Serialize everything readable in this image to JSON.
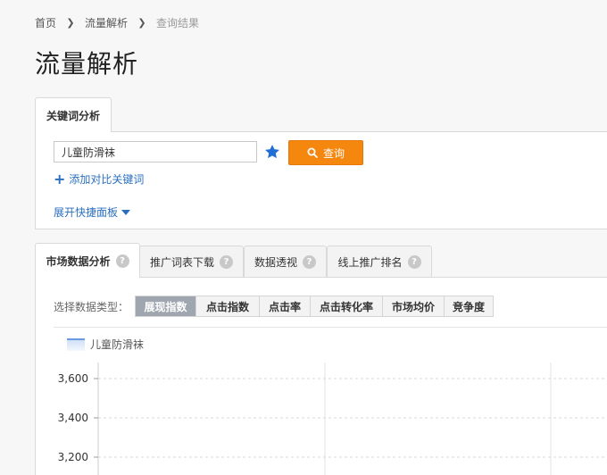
{
  "breadcrumb": {
    "home": "首页",
    "section": "流量解析",
    "current": "查询结果"
  },
  "page_title": "流量解析",
  "keyword_tab": {
    "label": "关键词分析"
  },
  "keyword_search": {
    "value": "儿童防滑袜",
    "search_label": "查询",
    "add_compare_label": "添加对比关键词",
    "expand_panel_label": "展开快捷面板"
  },
  "tabs": [
    {
      "label": "市场数据分析",
      "active": true
    },
    {
      "label": "推广词表下载",
      "active": false
    },
    {
      "label": "数据透视",
      "active": false
    },
    {
      "label": "线上推广排名",
      "active": false
    }
  ],
  "data_type": {
    "label": "选择数据类型：",
    "options": [
      "展现指数",
      "点击指数",
      "点击率",
      "点击转化率",
      "市场均价",
      "竞争度"
    ],
    "selected": "展现指数"
  },
  "colors": {
    "accent": "#f5860e",
    "link": "#2a6fbf",
    "series": "#6a9be0"
  },
  "chart_data": {
    "type": "area",
    "series": [
      {
        "name": "儿童防滑袜",
        "values": []
      }
    ],
    "y_ticks": [
      "3,600",
      "3,400",
      "3,200"
    ],
    "y_tick_values": [
      3600,
      3400,
      3200
    ],
    "ylim": [
      3200,
      3600
    ],
    "grid": true,
    "legend": "top-left"
  }
}
